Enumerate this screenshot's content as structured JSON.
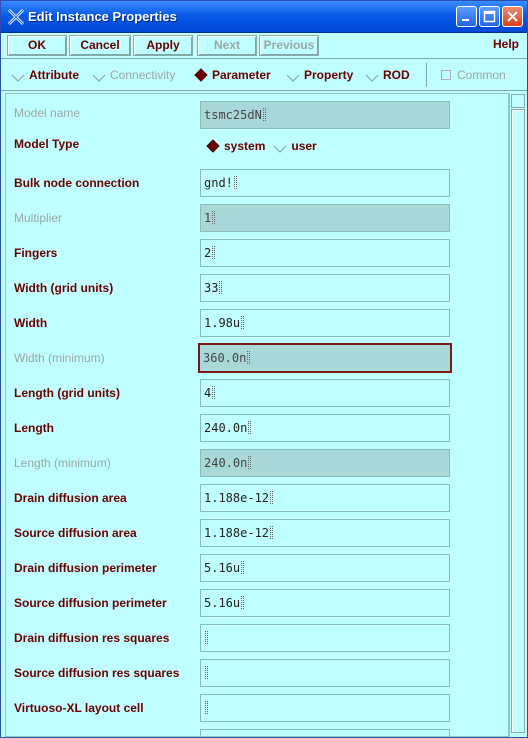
{
  "window": {
    "title": "Edit Instance Properties"
  },
  "buttons": {
    "ok": "OK",
    "cancel": "Cancel",
    "apply": "Apply",
    "next": "Next",
    "previous": "Previous",
    "help": "Help"
  },
  "tabs": {
    "attribute": "Attribute",
    "connectivity": "Connectivity",
    "parameter": "Parameter",
    "property": "Property",
    "rod": "ROD",
    "common": "Common"
  },
  "form": {
    "model_name": {
      "label": "Model name",
      "value": "tsmc25dN"
    },
    "model_type": {
      "label": "Model Type",
      "option_system": "system",
      "option_user": "user",
      "selected": "system"
    },
    "bulk_node": {
      "label": "Bulk node connection",
      "value": "gnd!"
    },
    "multiplier": {
      "label": "Multiplier",
      "value": "1"
    },
    "fingers": {
      "label": "Fingers",
      "value": "2"
    },
    "width_grid": {
      "label": "Width (grid units)",
      "value": "33"
    },
    "width": {
      "label": "Width",
      "value": "1.98u"
    },
    "width_min": {
      "label": "Width (minimum)",
      "value": "360.0n"
    },
    "length_grid": {
      "label": "Length (grid units)",
      "value": "4"
    },
    "length": {
      "label": "Length",
      "value": "240.0n"
    },
    "length_min": {
      "label": "Length (minimum)",
      "value": "240.0n"
    },
    "drain_area": {
      "label": "Drain diffusion area",
      "value": "1.188e-12"
    },
    "source_area": {
      "label": "Source diffusion area",
      "value": "1.188e-12"
    },
    "drain_perim": {
      "label": "Drain diffusion perimeter",
      "value": "5.16u"
    },
    "source_perim": {
      "label": "Source diffusion perimeter",
      "value": "5.16u"
    },
    "drain_res": {
      "label": "Drain diffusion res squares",
      "value": ""
    },
    "source_res": {
      "label": "Source diffusion res squares",
      "value": ""
    },
    "vxl_cell": {
      "label": "Virtuoso-XL layout cell",
      "value": ""
    }
  },
  "colors": {
    "background": "#c0ffff",
    "label": "#6a0000",
    "titlebar": "#0a5be8"
  }
}
